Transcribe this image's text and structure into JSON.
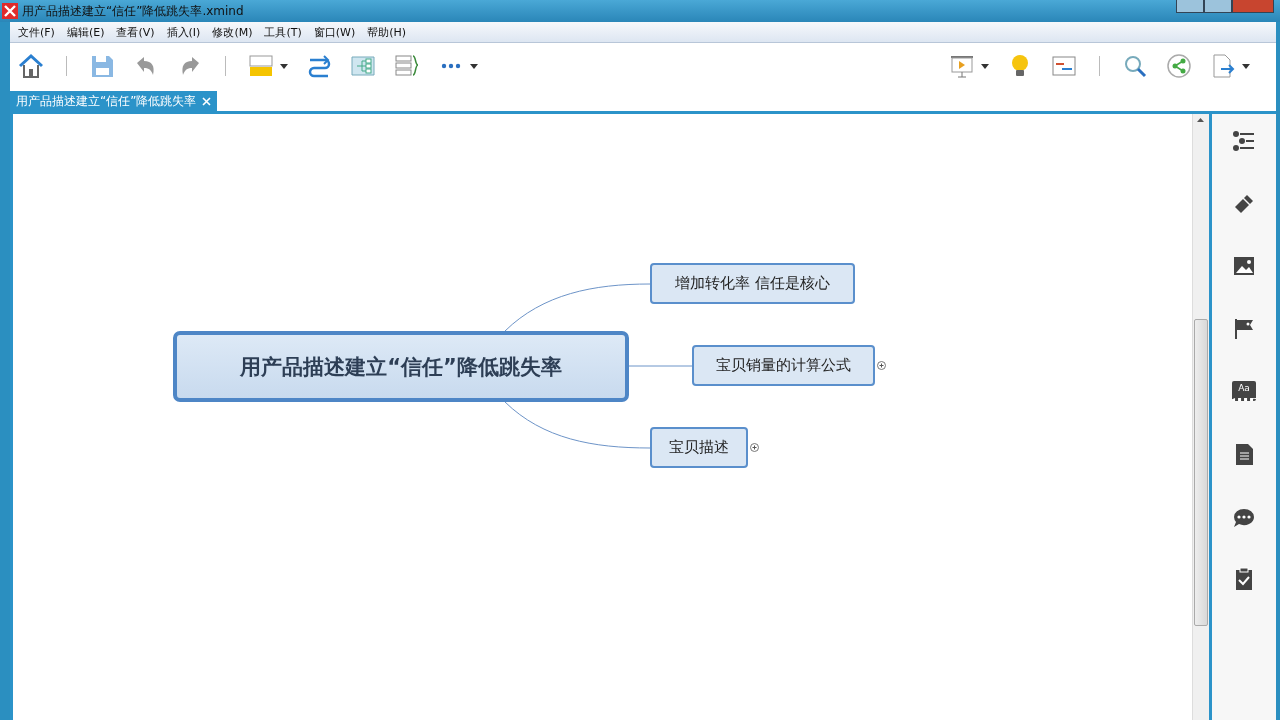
{
  "window": {
    "title": "用产品描述建立“信任”降低跳失率.xmind"
  },
  "menu": [
    "文件(F)",
    "编辑(E)",
    "查看(V)",
    "插入(I)",
    "修改(M)",
    "工具(T)",
    "窗口(W)",
    "帮助(H)"
  ],
  "tabs": [
    {
      "label": "用产品描述建立“信任”降低跳失率",
      "selected": true
    }
  ],
  "mindmap": {
    "central": "用产品描述建立“信任”降低跳失率",
    "topics": [
      {
        "label": "增加转化率 信任是核心",
        "collapsed": false
      },
      {
        "label": "宝贝销量的计算公式",
        "collapsed": true
      },
      {
        "label": "宝贝描述",
        "collapsed": true
      }
    ]
  },
  "sidebar": {
    "format_icon_label": "Aa"
  }
}
